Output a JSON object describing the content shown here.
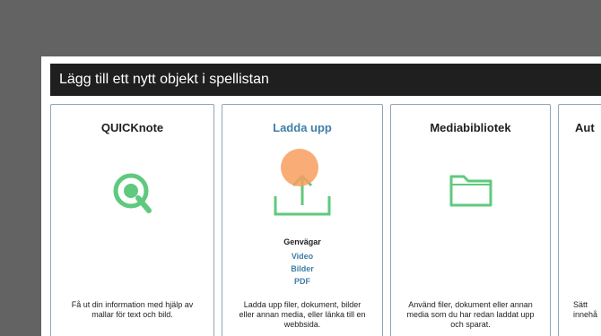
{
  "dialog": {
    "title": "Lägg till ett nytt objekt i spellistan"
  },
  "cards": {
    "quicknote": {
      "title": "QUICKnote",
      "icon": "quicknote-icon",
      "description": "Få ut din information med hjälp av mallar för text och bild."
    },
    "upload": {
      "title": "Ladda upp",
      "icon": "upload-icon",
      "shortcuts_heading": "Genvägar",
      "shortcuts": [
        "Video",
        "Bilder",
        "PDF"
      ],
      "description": "Ladda upp filer, dokument, bilder eller annan media, eller länka till en webbsida."
    },
    "media_library": {
      "title": "Mediabibliotek",
      "icon": "folder-icon",
      "description": "Använd filer, dokument eller annan media som du har redan laddat upp och sparat."
    },
    "partial": {
      "title": "Aut",
      "description_line1": "Sätt",
      "description_line2": "innehå"
    }
  },
  "colors": {
    "accent": "#3f7fa6",
    "icon_green": "#5fc97e",
    "cursor": "#f89e5e"
  }
}
